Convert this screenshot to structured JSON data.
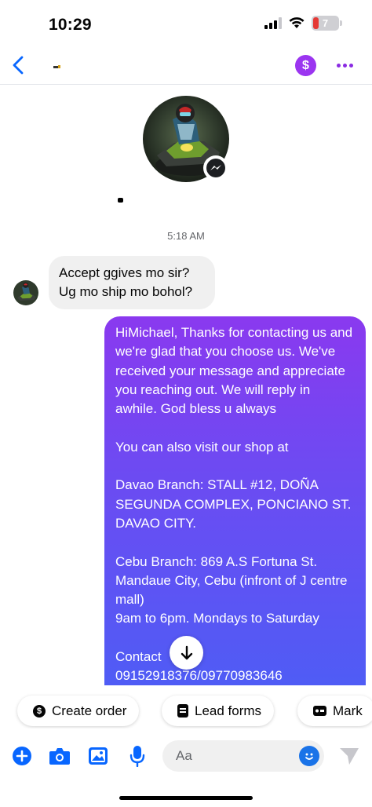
{
  "status_bar": {
    "time": "10:29",
    "battery": "7"
  },
  "header": {
    "dollar_label": "$"
  },
  "conversation": {
    "timestamp": "5:18 AM"
  },
  "messages": {
    "incoming_text": "Accept ggives mo sir?\nUg mo ship mo bohol?",
    "outgoing_text": "HiMichael, Thanks for contacting us and we're glad that you choose us. We've received your message and appreciate you reaching out. We will reply in awhile. God bless u always\n\nYou can also visit our shop at\n\nDavao Branch: STALL #12, DOÑA SEGUNDA COMPLEX, PONCIANO ST. DAVAO CITY.\n\nCebu Branch: 869 A.S Fortuna St. Mandaue City, Cebu (infront of J centre mall)\n9am to 6pm. Mondays to Saturday\n\nContact\n09152918376/09770983646"
  },
  "quick_actions": {
    "create_order": "Create order",
    "lead_forms": "Lead forms",
    "mark": "Mark"
  },
  "composer": {
    "placeholder": "Aa"
  },
  "colors": {
    "accent": "#0866ff",
    "dollar": "#9b35f0",
    "bubble_top": "#8a39ef",
    "bubble_bottom": "#4f5cf5"
  }
}
